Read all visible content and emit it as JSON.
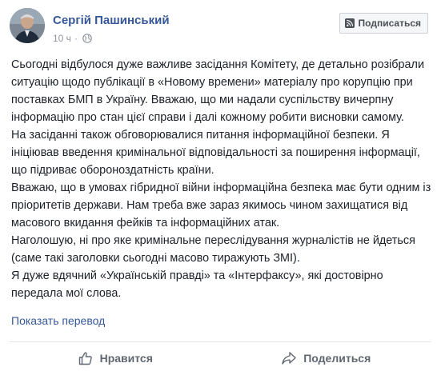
{
  "post": {
    "author": "Сергій Пашинський",
    "time": "10 ч",
    "separator": "·",
    "subscribe_label": "Подписаться",
    "paragraphs": [
      "Сьогодні відбулося дуже важливе засідання Комітету, де детально розібрали ситуацію щодо публікації в «Новому времени» матеріалу про корупцію при поставках БМП в Україну. Вважаю, що ми надали суспільству вичерпну інформацію про стан цієї справи і далі кожному робити висновки самому.",
      "На засіданні також обговорювалися питання інформаційної безпеки. Я ініціював введення кримінальної відповідальності за поширення інформації, що підриває обороноздатність країни.",
      "Вважаю, що в умовах гібридної війни інформаційна безпека має бути одним із пріоритетів держави. Нам треба вже зараз якимось чином захищатися від масового вкидання фейків та інформаційних атак.",
      "Наголошую, ні про яке кримінальне переслідування журналістів не йдеться (саме такі заголовки сьогодні масово тиражують ЗМІ).",
      "Я дуже вдячний «Українській правді» та «Інтерфаксу», які достовірно передала мої слова."
    ],
    "translate_label": "Показать перевод"
  },
  "actions": {
    "like_label": "Нравится",
    "share_label": "Поделиться"
  },
  "colors": {
    "link": "#365899",
    "text": "#1d2129",
    "muted": "#90949c",
    "action": "#606770"
  },
  "icons": {
    "privacy": "globe-icon",
    "subscribe": "rss-icon",
    "like": "thumbs-up-icon",
    "share": "share-arrow-icon"
  }
}
